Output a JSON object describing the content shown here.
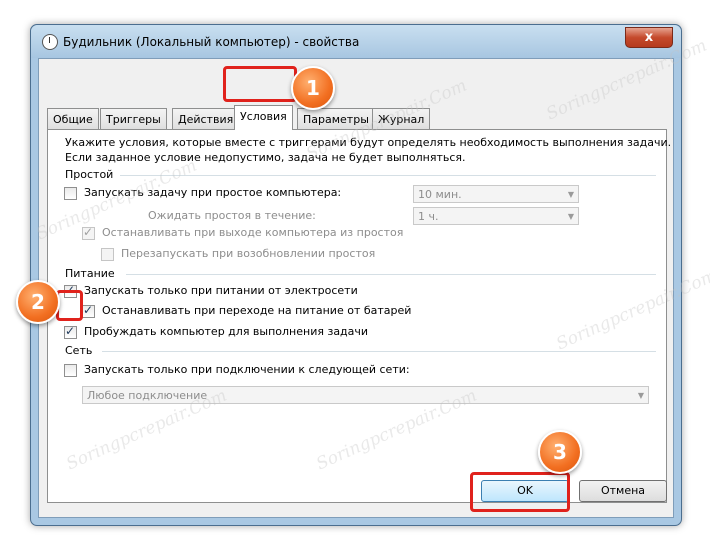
{
  "window": {
    "title": "Будильник (Локальный компьютер) - свойства",
    "close_symbol": "x"
  },
  "tabs": [
    {
      "label": "Общие",
      "active": false
    },
    {
      "label": "Триггеры",
      "active": false
    },
    {
      "label": "Действия",
      "active": false
    },
    {
      "label": "Условия",
      "active": true
    },
    {
      "label": "Параметры",
      "active": false
    },
    {
      "label": "Журнал",
      "active": false
    }
  ],
  "conditions": {
    "description_line1": "Укажите условия, которые вместе с триггерами будут определять необходимость выполнения задачи.",
    "description_line2": "Если заданное условие недопустимо, задача не будет выполняться.",
    "idle": {
      "group_label": "Простой",
      "start_on_idle_label": "Запускать задачу при простое компьютера:",
      "start_on_idle_checked": false,
      "idle_duration_value": "10 мин.",
      "wait_label": "Ожидать простоя в течение:",
      "wait_value": "1 ч.",
      "stop_on_idle_end_label": "Останавливать при выходе компьютера из простоя",
      "stop_on_idle_end_checked": true,
      "restart_on_idle_label": "Перезапускать при возобновлении простоя",
      "restart_on_idle_checked": false
    },
    "power": {
      "group_label": "Питание",
      "ac_only_label": "Запускать только при питании от электросети",
      "ac_only_checked": true,
      "stop_on_battery_label": "Останавливать при переходе на питание от батарей",
      "stop_on_battery_checked": true,
      "wake_label": "Пробуждать компьютер для выполнения задачи",
      "wake_checked": true
    },
    "network": {
      "group_label": "Сеть",
      "network_only_label": "Запускать только при подключении к следующей сети:",
      "network_only_checked": false,
      "network_value": "Любое подключение"
    }
  },
  "buttons": {
    "ok": "OK",
    "cancel": "Отмена"
  },
  "annotations": {
    "badge1": "1",
    "badge2": "2",
    "badge3": "3",
    "highlight_color": "#e0221c",
    "badge_color": "#f26f21"
  },
  "watermark": "Soringpcrepair.Com"
}
